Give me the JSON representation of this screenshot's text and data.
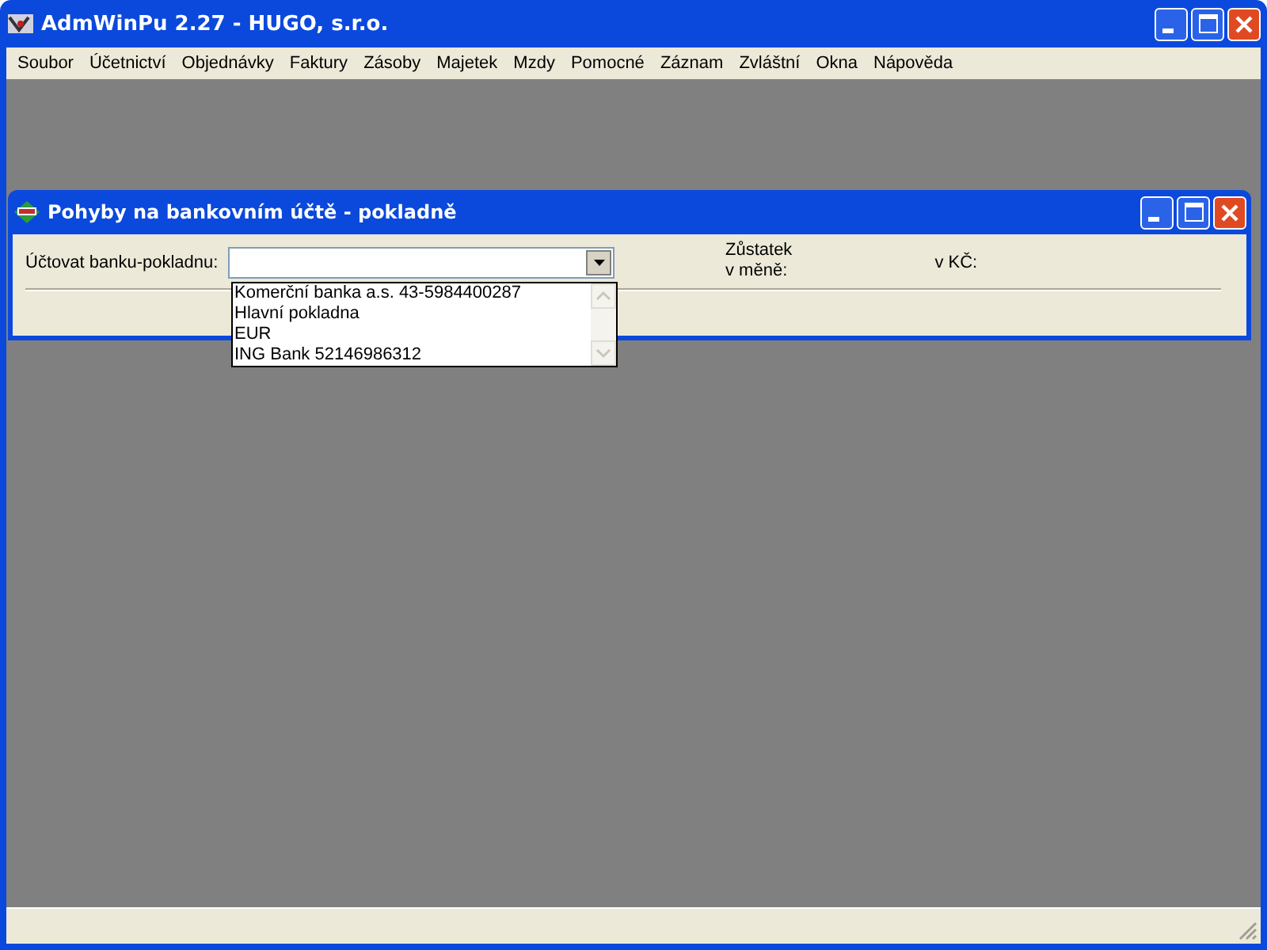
{
  "window": {
    "title": "AdmWinPu 2.27 - HUGO, s.r.o."
  },
  "menu": [
    "Soubor",
    "Účetnictví",
    "Objednávky",
    "Faktury",
    "Zásoby",
    "Majetek",
    "Mzdy",
    "Pomocné",
    "Záznam",
    "Zvláštní",
    "Okna",
    "Nápověda"
  ],
  "child_window": {
    "title": "Pohyby na bankovním účtě - pokladně",
    "account_label": "Účtovat banku-pokladnu:",
    "balance_label": "Zůstatek\nv měně:",
    "czk_label": "v KČ:",
    "dropdown": {
      "expanded": true,
      "options": [
        {
          "label": "Komerční banka a.s. 43-5984400287",
          "selected": false
        },
        {
          "label": "Hlavní pokladna",
          "selected": false
        },
        {
          "label": "EUR",
          "selected": false
        },
        {
          "label": "ING Bank 52146986312",
          "selected": false
        }
      ]
    }
  }
}
